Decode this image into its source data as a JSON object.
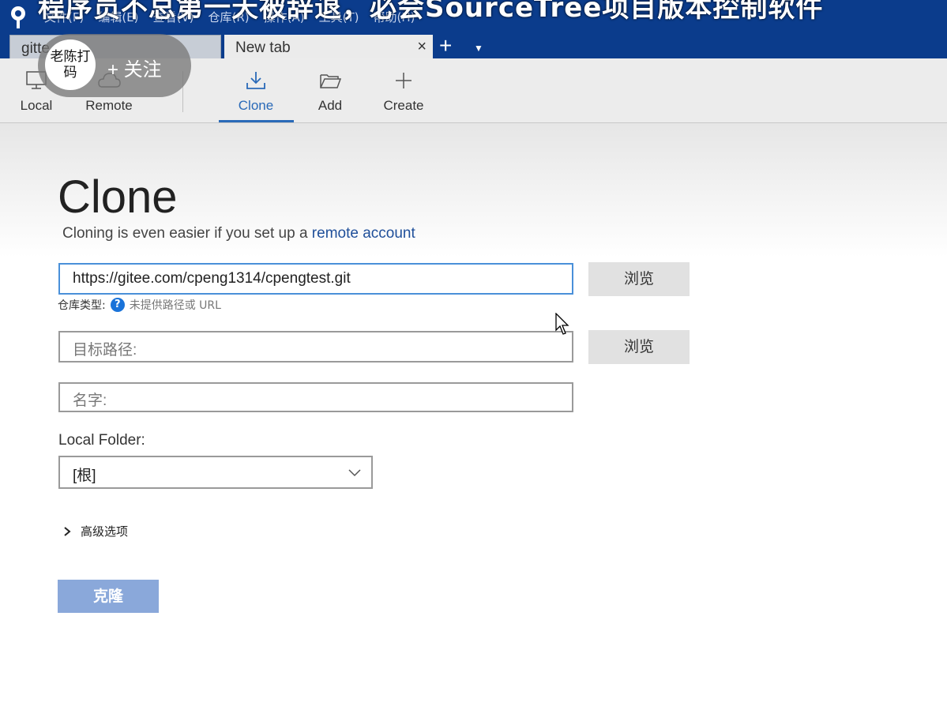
{
  "video_caption": "程序员不总第一天被辞退，必会SourceTree项目版本控制软件",
  "menu": [
    "文件(F)",
    "编辑(E)",
    "查看(V)",
    "仓库(R)",
    "操作(A)",
    "工具(T)",
    "帮助(H)"
  ],
  "tabs": [
    {
      "label": "gitte"
    },
    {
      "label": "New tab",
      "close": "×"
    }
  ],
  "tab_add": "+",
  "tab_dropdown": "▼",
  "follow": {
    "avatar_text": "老陈打码",
    "label": "+ 关注"
  },
  "toolbar": {
    "local": "Local",
    "remote": "Remote",
    "clone": "Clone",
    "add": "Add",
    "create": "Create"
  },
  "clone_page": {
    "title": "Clone",
    "subtitle_prefix": "Cloning is even easier if you set up a ",
    "subtitle_link": "remote account",
    "source_url": "https://gitee.com/cpeng1314/cpengtest.git",
    "browse_label": "浏览",
    "repo_type_label": "仓库类型:",
    "repo_type_help": "?",
    "repo_type_status": "未提供路径或 URL",
    "destination_placeholder": "目标路径:",
    "name_placeholder": "名字:",
    "local_folder_label": "Local Folder:",
    "local_folder_value": "[根]",
    "advanced_label": "高级选项",
    "clone_button": "克隆"
  },
  "colors": {
    "titlebar": "#0b3c8c",
    "accent": "#2a6ab8",
    "clone_button": "#8aa8da",
    "help_icon": "#1a73d9"
  }
}
